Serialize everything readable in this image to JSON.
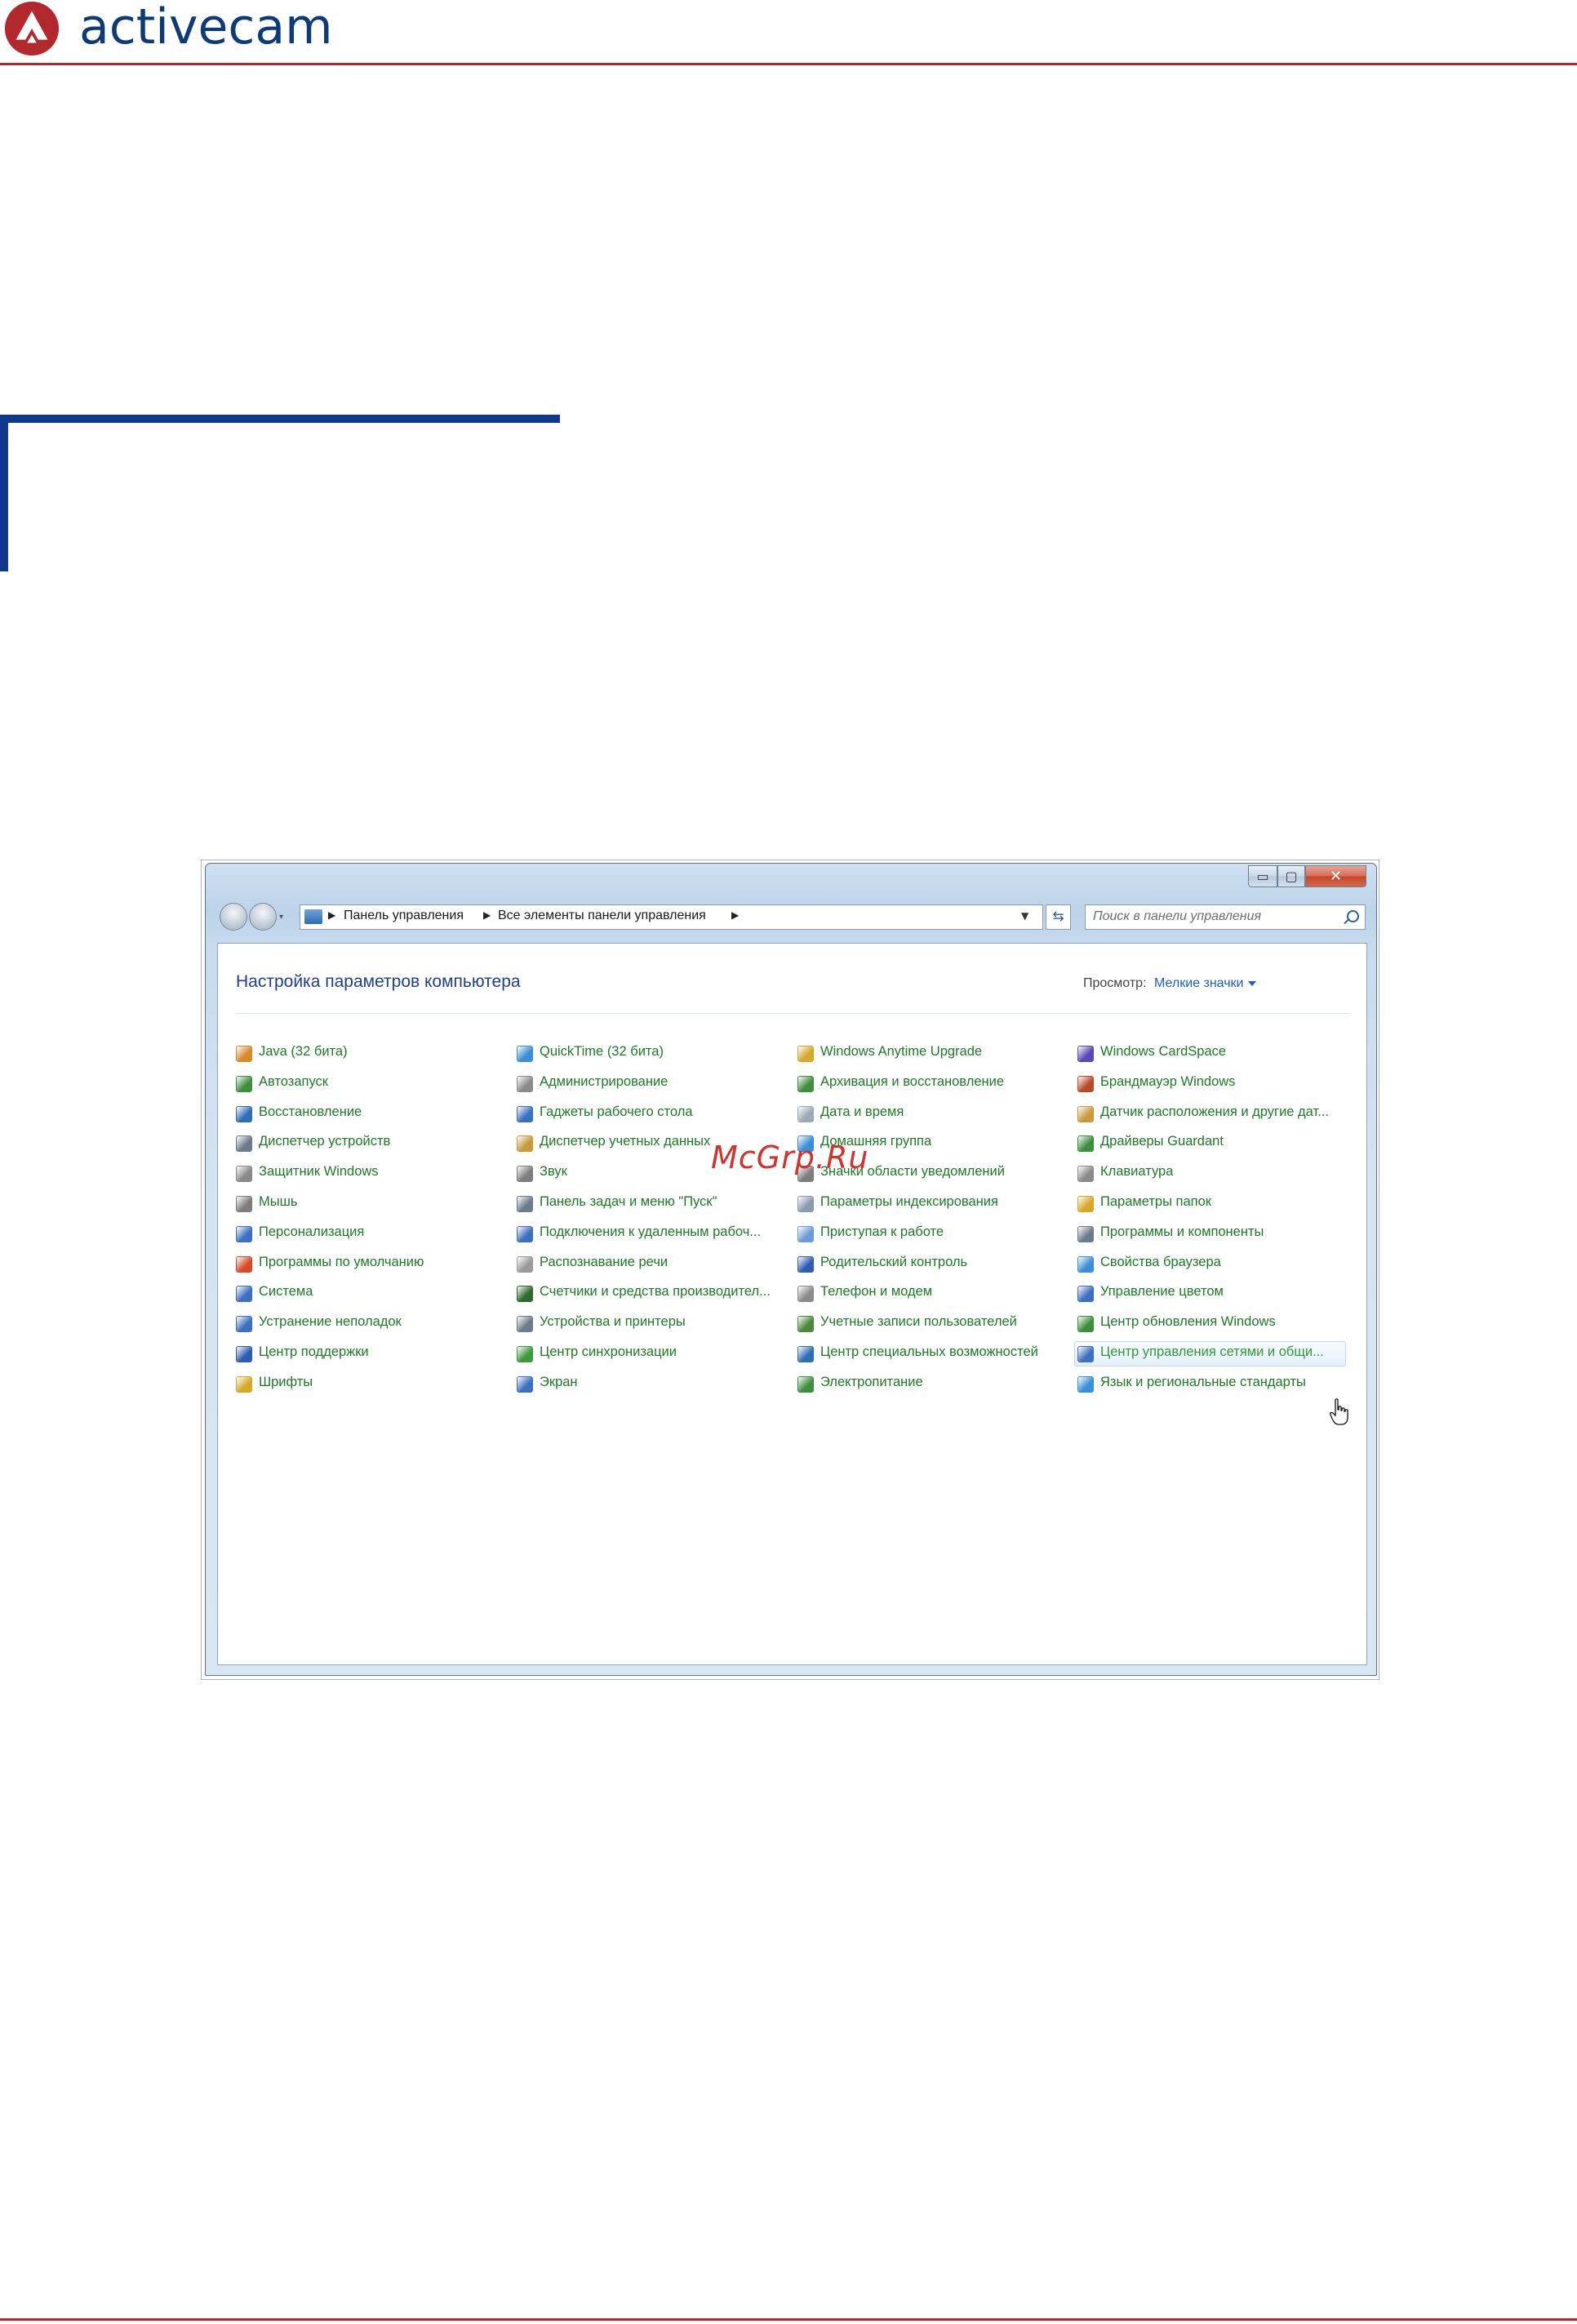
{
  "header": {
    "brand": "activecam",
    "colors": {
      "brand_text": "#0d3a78",
      "brand_red": "#b3282d",
      "accent_blue": "#10388c"
    }
  },
  "window": {
    "caption_buttons": {
      "minimize": "▭",
      "maximize": "▢",
      "close": "✕"
    },
    "breadcrumb": [
      "Панель управления",
      "Все элементы панели управления"
    ],
    "search": {
      "placeholder": "Поиск в панели управления"
    },
    "content": {
      "title": "Настройка параметров компьютера",
      "view_label": "Просмотр:",
      "view_value": "Мелкие значки"
    },
    "columns": [
      [
        {
          "label": "Java (32 бита)",
          "icon": "java-icon",
          "color": "#d88a2a"
        },
        {
          "label": "Автозапуск",
          "icon": "autoplay-icon",
          "color": "#3d8f3d"
        },
        {
          "label": "Восстановление",
          "icon": "recovery-icon",
          "color": "#2d6fb5"
        },
        {
          "label": "Диспетчер устройств",
          "icon": "device-manager-icon",
          "color": "#6b7b8c"
        },
        {
          "label": "Защитник Windows",
          "icon": "defender-icon",
          "color": "#8a8a8a"
        },
        {
          "label": "Мышь",
          "icon": "mouse-icon",
          "color": "#7d7d7d"
        },
        {
          "label": "Персонализация",
          "icon": "personalization-icon",
          "color": "#3b6fc2"
        },
        {
          "label": "Программы по умолчанию",
          "icon": "default-programs-icon",
          "color": "#d84a2a"
        },
        {
          "label": "Система",
          "icon": "system-icon",
          "color": "#3b6fc2"
        },
        {
          "label": "Устранение неполадок",
          "icon": "troubleshooting-icon",
          "color": "#3b6fc2"
        },
        {
          "label": "Центр поддержки",
          "icon": "action-center-flag-icon",
          "color": "#2d5bb5"
        },
        {
          "label": "Шрифты",
          "icon": "fonts-icon",
          "color": "#d8a82a"
        }
      ],
      [
        {
          "label": "QuickTime (32 бита)",
          "icon": "quicktime-icon",
          "color": "#3b8fd8"
        },
        {
          "label": "Администрирование",
          "icon": "administration-icon",
          "color": "#8a8a8a"
        },
        {
          "label": "Гаджеты рабочего стола",
          "icon": "gadgets-icon",
          "color": "#3b6fc2"
        },
        {
          "label": "Диспетчер учетных данных",
          "icon": "credential-manager-icon",
          "color": "#c89a3a"
        },
        {
          "label": "Звук",
          "icon": "sound-icon",
          "color": "#7d7d7d"
        },
        {
          "label": "Панель задач и меню \"Пуск\"",
          "icon": "taskbar-icon",
          "color": "#6b7b8c"
        },
        {
          "label": "Подключения к удаленным рабоч...",
          "icon": "remoteapp-icon",
          "color": "#3b6fc2"
        },
        {
          "label": "Распознавание речи",
          "icon": "speech-icon",
          "color": "#9a9a9a"
        },
        {
          "label": "Счетчики и средства производител...",
          "icon": "performance-icon",
          "color": "#2d6a2d"
        },
        {
          "label": "Устройства и принтеры",
          "icon": "printers-icon",
          "color": "#6b7b8c"
        },
        {
          "label": "Центр синхронизации",
          "icon": "sync-center-icon",
          "color": "#3d9a3d"
        },
        {
          "label": "Экран",
          "icon": "display-icon",
          "color": "#3b6fc2"
        }
      ],
      [
        {
          "label": "Windows Anytime Upgrade",
          "icon": "windows-flag-icon",
          "color": "#d8a82a"
        },
        {
          "label": "Архивация и восстановление",
          "icon": "backup-icon",
          "color": "#3d8f3d"
        },
        {
          "label": "Дата и время",
          "icon": "date-time-icon",
          "color": "#9aaab8"
        },
        {
          "label": "Домашняя группа",
          "icon": "homegroup-icon",
          "color": "#3b8fd8"
        },
        {
          "label": "Значки области уведомлений",
          "icon": "notification-icons-icon",
          "color": "#7d7d7d"
        },
        {
          "label": "Параметры индексирования",
          "icon": "indexing-icon",
          "color": "#8a9ab0"
        },
        {
          "label": "Приступая к работе",
          "icon": "getting-started-icon",
          "color": "#6b9bd8"
        },
        {
          "label": "Родительский контроль",
          "icon": "parental-controls-icon",
          "color": "#2d5bb5"
        },
        {
          "label": "Телефон и модем",
          "icon": "phone-modem-icon",
          "color": "#8a8a8a"
        },
        {
          "label": "Учетные записи пользователей",
          "icon": "user-accounts-icon",
          "color": "#4a8a3a"
        },
        {
          "label": "Центр специальных возможностей",
          "icon": "ease-of-access-icon",
          "color": "#2d6fb5"
        },
        {
          "label": "Электропитание",
          "icon": "power-options-icon",
          "color": "#3d8f3d"
        }
      ],
      [
        {
          "label": "Windows CardSpace",
          "icon": "cardspace-icon",
          "color": "#5a4ab8"
        },
        {
          "label": "Брандмауэр Windows",
          "icon": "firewall-icon",
          "color": "#b84a2a"
        },
        {
          "label": "Датчик расположения и другие дат...",
          "icon": "location-sensor-icon",
          "color": "#c89a3a"
        },
        {
          "label": "Драйверы Guardant",
          "icon": "guardant-icon",
          "color": "#3d8f3d"
        },
        {
          "label": "Клавиатура",
          "icon": "keyboard-icon",
          "color": "#8a8a8a"
        },
        {
          "label": "Параметры папок",
          "icon": "folder-options-icon",
          "color": "#d8a82a"
        },
        {
          "label": "Программы и компоненты",
          "icon": "programs-features-icon",
          "color": "#6b7b8c"
        },
        {
          "label": "Свойства браузера",
          "icon": "internet-options-icon",
          "color": "#3b8fd8"
        },
        {
          "label": "Управление цветом",
          "icon": "color-management-icon",
          "color": "#3b6fc2"
        },
        {
          "label": "Центр обновления Windows",
          "icon": "windows-update-icon",
          "color": "#3d8f3d"
        },
        {
          "label": "Центр управления сетями и общи...",
          "icon": "network-center-icon",
          "color": "#3b6fc2",
          "highlighted": true
        },
        {
          "label": "Язык и региональные стандарты",
          "icon": "region-language-icon",
          "color": "#3b8fd8"
        }
      ]
    ]
  },
  "watermark": "McGrp.Ru"
}
